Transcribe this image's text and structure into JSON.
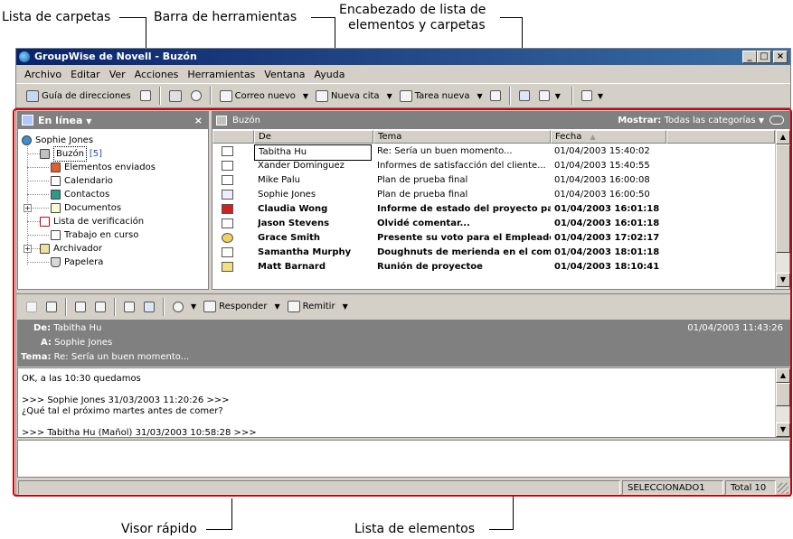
{
  "callouts": {
    "folder_list": "Lista de carpetas",
    "toolbar": "Barra de herramientas",
    "header_line1": "Encabezado de lista de",
    "header_line2": "elementos y carpetas",
    "quick_viewer": "Visor rápido",
    "item_list": "Lista de elementos"
  },
  "window": {
    "title": "GroupWise de Novell - Buzón",
    "controls": [
      "_",
      "□",
      "×"
    ]
  },
  "menu": [
    "Archivo",
    "Editar",
    "Ver",
    "Acciones",
    "Herramientas",
    "Ventana",
    "Ayuda"
  ],
  "toolbar": {
    "address_book": "Guía de direcciones",
    "new_mail": "Correo nuevo",
    "new_appt": "Nueva cita",
    "new_task": "Tarea nueva"
  },
  "folders": {
    "header": "En línea",
    "close": "×",
    "user": "Sophie Jones",
    "items": [
      {
        "label": "Buzón",
        "count": "[5]"
      },
      {
        "label": "Elementos enviados"
      },
      {
        "label": "Calendario"
      },
      {
        "label": "Contactos"
      },
      {
        "label": "Documentos"
      },
      {
        "label": "Lista de verificación"
      },
      {
        "label": "Trabajo en curso"
      },
      {
        "label": "Archivador"
      },
      {
        "label": "Papelera"
      }
    ]
  },
  "itemlist": {
    "folder_name": "Buzón",
    "show_label": "Mostrar:",
    "show_value": "Todas las categorías",
    "columns": {
      "from": "De",
      "subject": "Tema",
      "date": "Fecha"
    },
    "rows": [
      {
        "from": "Tabitha Hu",
        "subject": "Re: Sería un buen momento...",
        "date": "01/04/2003 15:40:02",
        "unread": false
      },
      {
        "from": "Xander Dominguez",
        "subject": "Informes de satisfacción del cliente...",
        "date": "01/04/2003 15:40:55",
        "unread": false
      },
      {
        "from": "Mike Palu",
        "subject": "Plan de prueba final",
        "date": "01/04/2003 16:00:08",
        "unread": false
      },
      {
        "from": "Sophie Jones",
        "subject": "Plan de prueba final",
        "date": "01/04/2003 16:00:50",
        "unread": false
      },
      {
        "from": "Claudia Wong",
        "subject": "Informe de estado del proyecto par",
        "date": "01/04/2003 16:01:18",
        "unread": true
      },
      {
        "from": "Jason Stevens",
        "subject": "Olvidé comentar...",
        "date": "01/04/2003 16:01:18",
        "unread": true
      },
      {
        "from": "Grace Smith",
        "subject": "Presente su voto para el Empleado",
        "date": "01/04/2003 17:02:17",
        "unread": true
      },
      {
        "from": "Samantha Murphy",
        "subject": "Doughnuts de merienda en el come",
        "date": "01/04/2003 18:01:18",
        "unread": true
      },
      {
        "from": "Matt Barnard",
        "subject": "Runión de proyectoe",
        "date": "01/04/2003 18:10:41",
        "unread": true
      }
    ]
  },
  "quickviewer": {
    "reply": "Responder",
    "forward": "Remitir",
    "to_label": "De:",
    "to_value": "Tabitha Hu",
    "a_label": "A:",
    "a_value": "Sophie Jones",
    "subject_label": "Tema:",
    "subject_value": "Re: Sería un buen momento...",
    "date": "01/04/2003 11:43:26",
    "body_line1": "OK, a las 10:30 quedamos",
    "body_line2": ">>> Sophie Jones 31/03/2003 11:20:26 >>>",
    "body_line3": "¿Qué tal el próximo martes antes de comer?",
    "body_line4": ">>> Tabitha Hu (Mañol) 31/03/2003 10:58:28 >>>"
  },
  "status": {
    "selected": "SELECCIONADO1",
    "total": "Total 10"
  }
}
